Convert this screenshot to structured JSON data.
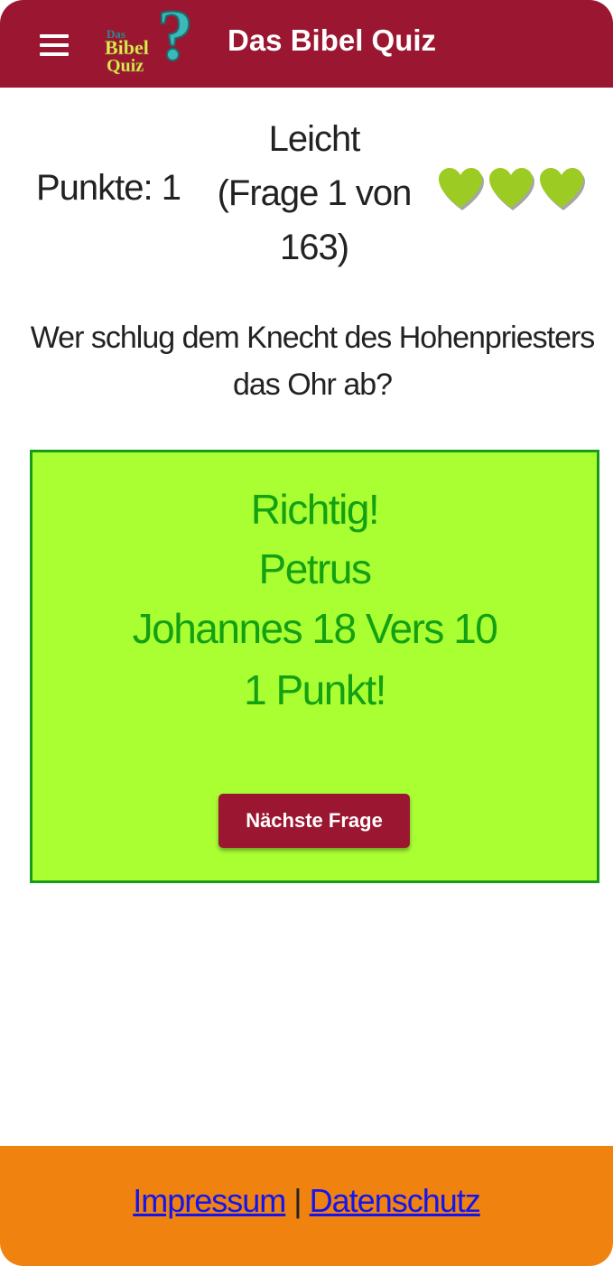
{
  "appbar": {
    "title": "Das Bibel Quiz",
    "logo": {
      "das": "Das",
      "bibel": "Bibel",
      "quiz": "Quiz",
      "mark": "?"
    },
    "menu_icon": "hamburger-menu-icon"
  },
  "status": {
    "score": "Punkte: 1",
    "level": "Leicht",
    "progress_line1": "(Frage 1 von",
    "progress_line2": "163)",
    "lives_remaining": 3,
    "lives_icon": "heart-icon",
    "heart_color": "#9ccc23"
  },
  "question": {
    "text": "Wer schlug dem Knecht des Hohenpriesters das Ohr ab?"
  },
  "answer": {
    "result": "Richtig!",
    "answer_text": "Petrus",
    "reference": "Johannes 18 Vers 10",
    "points": "1 Punkt!",
    "next_button": "Nächste Frage"
  },
  "footer": {
    "impressum": "Impressum",
    "separator": "|",
    "datenschutz": "Datenschutz"
  },
  "colors": {
    "primary": "#9b1631",
    "answer_bg": "#aaff33",
    "answer_text": "#13a113",
    "footer_bg": "#f08210",
    "link": "#1414ee"
  }
}
